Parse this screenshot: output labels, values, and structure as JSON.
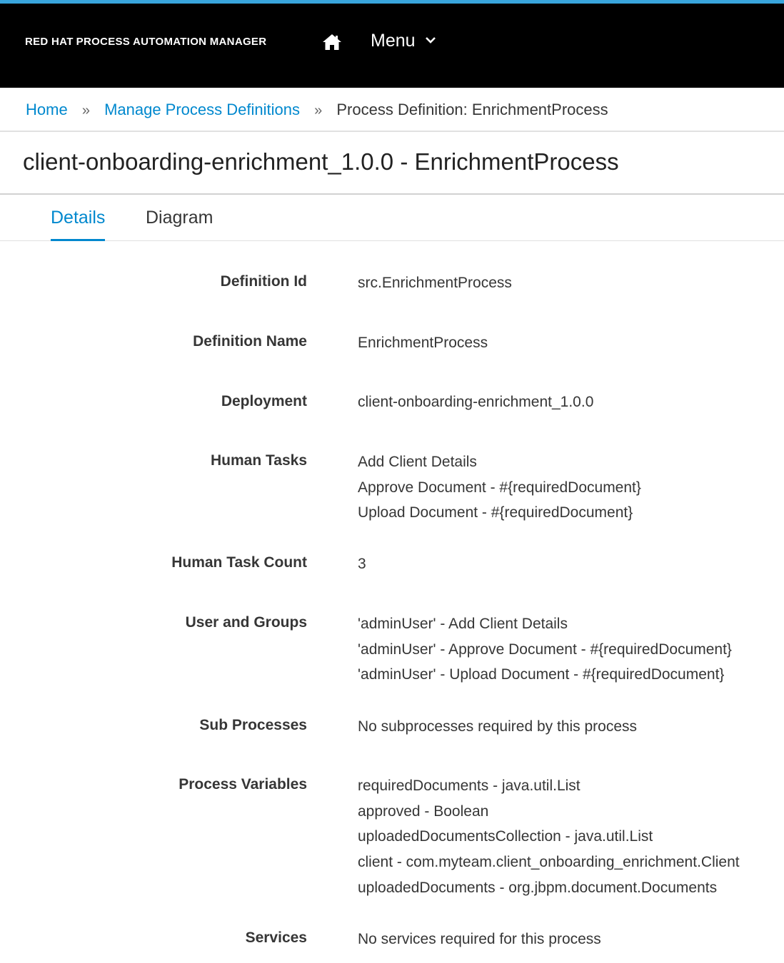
{
  "header": {
    "brand_primary": "RED HAT",
    "brand_secondary": "PROCESS AUTOMATION MANAGER",
    "menu_label": "Menu",
    "home_icon": "home-icon",
    "menu_chevron_icon": "chevron-down-icon",
    "accent_color": "#39a5dc"
  },
  "breadcrumb": {
    "home": "Home",
    "separator": "»",
    "manage": "Manage Process Definitions",
    "current": "Process Definition: EnrichmentProcess"
  },
  "page": {
    "title": "client-onboarding-enrichment_1.0.0 - EnrichmentProcess"
  },
  "tabs": [
    {
      "label": "Details",
      "active": true
    },
    {
      "label": "Diagram",
      "active": false
    }
  ],
  "details": {
    "definition_id": {
      "label": "Definition Id",
      "value": "src.EnrichmentProcess"
    },
    "definition_name": {
      "label": "Definition Name",
      "value": "EnrichmentProcess"
    },
    "deployment": {
      "label": "Deployment",
      "value": "client-onboarding-enrichment_1.0.0"
    },
    "human_tasks": {
      "label": "Human Tasks",
      "values": [
        "Add Client Details",
        "Approve Document - #{requiredDocument}",
        "Upload Document - #{requiredDocument}"
      ]
    },
    "human_task_count": {
      "label": "Human Task Count",
      "value": "3"
    },
    "user_groups": {
      "label": "User and Groups",
      "values": [
        "'adminUser' - Add Client Details",
        "'adminUser' - Approve Document - #{requiredDocument}",
        "'adminUser' - Upload Document - #{requiredDocument}"
      ]
    },
    "sub_processes": {
      "label": "Sub Processes",
      "value": "No subprocesses required by this process"
    },
    "process_variables": {
      "label": "Process Variables",
      "values": [
        "requiredDocuments - java.util.List",
        "approved - Boolean",
        "uploadedDocumentsCollection - java.util.List",
        "client - com.myteam.client_onboarding_enrichment.Client",
        "uploadedDocuments - org.jbpm.document.Documents"
      ]
    },
    "services": {
      "label": "Services",
      "value": "No services required for this process"
    }
  }
}
